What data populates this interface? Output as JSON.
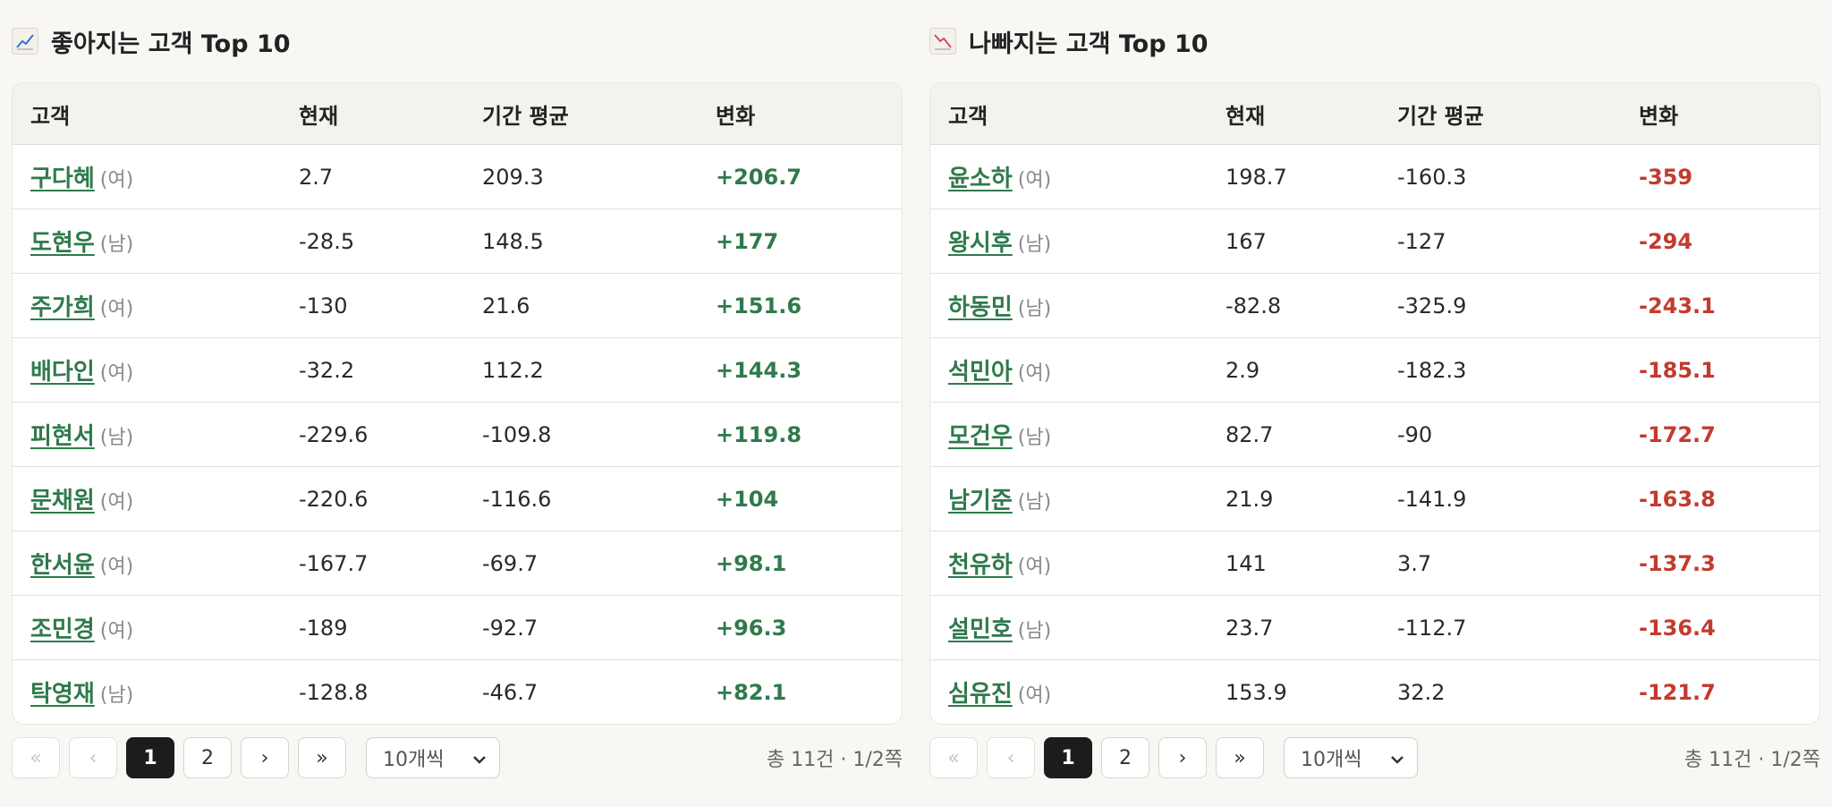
{
  "panels": [
    {
      "title": "좋아지는 고객 Top 10",
      "icon": "chart-increasing-icon",
      "headers": [
        "고객",
        "현재",
        "기간 평균",
        "변화"
      ],
      "rows": [
        {
          "name": "구다혜",
          "gender": "(여)",
          "current": "2.7",
          "average": "209.3",
          "change": "+206.7"
        },
        {
          "name": "도현우",
          "gender": "(남)",
          "current": "-28.5",
          "average": "148.5",
          "change": "+177"
        },
        {
          "name": "주가희",
          "gender": "(여)",
          "current": "-130",
          "average": "21.6",
          "change": "+151.6"
        },
        {
          "name": "배다인",
          "gender": "(여)",
          "current": "-32.2",
          "average": "112.2",
          "change": "+144.3"
        },
        {
          "name": "피현서",
          "gender": "(남)",
          "current": "-229.6",
          "average": "-109.8",
          "change": "+119.8"
        },
        {
          "name": "문채원",
          "gender": "(여)",
          "current": "-220.6",
          "average": "-116.6",
          "change": "+104"
        },
        {
          "name": "한서윤",
          "gender": "(여)",
          "current": "-167.7",
          "average": "-69.7",
          "change": "+98.1"
        },
        {
          "name": "조민경",
          "gender": "(여)",
          "current": "-189",
          "average": "-92.7",
          "change": "+96.3"
        },
        {
          "name": "탁영재",
          "gender": "(남)",
          "current": "-128.8",
          "average": "-46.7",
          "change": "+82.1"
        }
      ],
      "pagination": {
        "first": "«",
        "prev": "‹",
        "pages": [
          "1",
          "2"
        ],
        "active_page": "1",
        "next": "›",
        "last": "»"
      },
      "page_size": "10개씩",
      "total": "총 11건 · 1/2쪽"
    },
    {
      "title": "나빠지는 고객 Top 10",
      "icon": "chart-decreasing-icon",
      "headers": [
        "고객",
        "현재",
        "기간 평균",
        "변화"
      ],
      "rows": [
        {
          "name": "윤소하",
          "gender": "(여)",
          "current": "198.7",
          "average": "-160.3",
          "change": "-359"
        },
        {
          "name": "왕시후",
          "gender": "(남)",
          "current": "167",
          "average": "-127",
          "change": "-294"
        },
        {
          "name": "하동민",
          "gender": "(남)",
          "current": "-82.8",
          "average": "-325.9",
          "change": "-243.1"
        },
        {
          "name": "석민아",
          "gender": "(여)",
          "current": "2.9",
          "average": "-182.3",
          "change": "-185.1"
        },
        {
          "name": "모건우",
          "gender": "(남)",
          "current": "82.7",
          "average": "-90",
          "change": "-172.7"
        },
        {
          "name": "남기준",
          "gender": "(남)",
          "current": "21.9",
          "average": "-141.9",
          "change": "-163.8"
        },
        {
          "name": "천유하",
          "gender": "(여)",
          "current": "141",
          "average": "3.7",
          "change": "-137.3"
        },
        {
          "name": "설민호",
          "gender": "(남)",
          "current": "23.7",
          "average": "-112.7",
          "change": "-136.4"
        },
        {
          "name": "심유진",
          "gender": "(여)",
          "current": "153.9",
          "average": "32.2",
          "change": "-121.7"
        }
      ],
      "pagination": {
        "first": "«",
        "prev": "‹",
        "pages": [
          "1",
          "2"
        ],
        "active_page": "1",
        "next": "›",
        "last": "»"
      },
      "page_size": "10개씩",
      "total": "총 11건 · 1/2쪽"
    }
  ],
  "colors": {
    "positive": "#2f7a4c",
    "negative": "#c23b2f",
    "active_page": "#1c1c1c"
  }
}
